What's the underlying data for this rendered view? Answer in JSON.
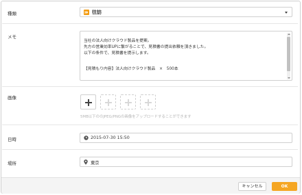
{
  "form": {
    "type": {
      "label": "種類",
      "value": "往訪",
      "icon": "visit-arrow-icon",
      "accent": "#f39c12"
    },
    "memo": {
      "label": "メモ",
      "lines": [
        "当社の法人向けクラウド製品を提案。",
        "先方の営業効率UPに繋がることで、見積書の提出依頼を頂きました。",
        "以下の条件で、見積書を提示します。",
        "",
        "【見積もり内容】法人向けクラウド製品　×　500本"
      ]
    },
    "images": {
      "label": "画像",
      "note": "5MB以下ののJPEG/PNGの画像をアップロードすることができます"
    },
    "datetime": {
      "label": "日時",
      "value": "2015-07-30 15:50",
      "icon": "clock-icon"
    },
    "place": {
      "label": "場所",
      "value": "東京",
      "icon": "map-pin-icon"
    }
  },
  "footer": {
    "cancel_label": "キャンセル",
    "ok_label": "OK",
    "ok_color": "#f5a623"
  }
}
